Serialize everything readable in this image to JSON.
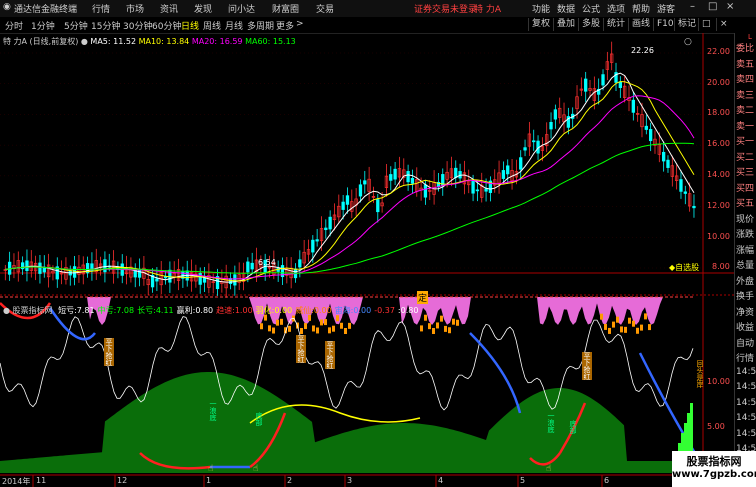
{
  "menubar": {
    "app_title": "通达信金融终端",
    "menus": [
      "行情",
      "市场",
      "资讯",
      "发现",
      "问小达",
      "财富圈",
      "交易"
    ],
    "warning": "证券交易未登录",
    "stock_name": "特 力A",
    "right_items": [
      "功能",
      "数据",
      "公式",
      "选项",
      "帮助",
      "游客"
    ]
  },
  "toolbar": {
    "periods": [
      "分时",
      "1分钟",
      "5分钟",
      "15分钟",
      "30分钟",
      "60分钟",
      "日线",
      "周线",
      "月线",
      "多周期",
      "更多"
    ],
    "more_arrow": ">",
    "buttons": [
      "复权",
      "叠加",
      "多股",
      "统计",
      "画线",
      "F10",
      "标记"
    ],
    "close": "×",
    "restore": "□"
  },
  "main_legend": {
    "title": "特 力A (日线,前复权)",
    "ma5": "MA5: 11.52",
    "ma10": "MA10: 13.84",
    "ma20": "MA20: 16.59",
    "ma60": "MA60: 15.13",
    "auto_label": "◆自选股"
  },
  "price_axis": [
    "22.00",
    "20.00",
    "18.00",
    "16.00",
    "14.00",
    "12.00",
    "10.00",
    "8.00"
  ],
  "annotations": {
    "high": "22.26",
    "low": "6.54",
    "ding_badge": "定"
  },
  "indicator_legend": {
    "name": "股票指标网",
    "items": [
      {
        "label": "短亏:",
        "value": "7.81",
        "color": "#ffffff"
      },
      {
        "label": "中亏:",
        "value": "7.08",
        "color": "#00ff00"
      },
      {
        "label": "长亏:",
        "value": "4.11",
        "color": "#00ff00"
      },
      {
        "label": "赢利:",
        "value": "0.80",
        "color": "#ffffff"
      },
      {
        "label": "趋速:",
        "value": "1.00",
        "color": "#ff3030"
      },
      {
        "label": "羽化:",
        "value": "0.00",
        "color": "#ffff00"
      },
      {
        "label": "威仙:",
        "value": "0.00",
        "color": "#ff8800"
      },
      {
        "label": "宙海:",
        "value": "0.00",
        "color": "#4488ff"
      },
      {
        "label": "",
        "value": "-0.37",
        "color": "#ff3030"
      },
      {
        "label": ":",
        "value": "0.80",
        "color": "#ffffff"
      }
    ]
  },
  "indicator_axis": [
    "10.00",
    "5.00"
  ],
  "indicator_texts": {
    "dao1": "一浪底",
    "dao2": "一浪底",
    "bottom1": "底部",
    "bottom2": "底部",
    "buy_tags": [
      "平下抢红",
      "平下抢红",
      "平下抢红",
      "平下抢红"
    ],
    "top_tag": "回头是岸"
  },
  "date_axis": [
    "2014年",
    "11",
    "12",
    "1",
    "2",
    "3",
    "4",
    "5",
    "6"
  ],
  "right_column": {
    "items": [
      "委比",
      "卖五",
      "卖四",
      "卖三",
      "卖二",
      "卖一",
      "买一",
      "买二",
      "买三",
      "买四",
      "买五",
      "现价",
      "涨跌",
      "涨幅",
      "总量",
      "外盘",
      "换手",
      "净资",
      "收益",
      "自动",
      "行情",
      "14:56",
      "14:56",
      "14:56",
      "14:56",
      "14:56",
      "14:56",
      "14:56",
      "14:56"
    ],
    "marker": "L"
  },
  "watermark": {
    "line1": "股票指标网",
    "line2": "www.7gpzb.com"
  },
  "colors": {
    "up": "#ff3030",
    "down": "#00ffff",
    "ma5": "#ffffff",
    "ma10": "#ffff00",
    "ma20": "#ff00ff",
    "ma60": "#00ff00",
    "green_fill": "#0a6e0a",
    "magenta_fill": "#ff77ee",
    "orange": "#ff9900"
  }
}
